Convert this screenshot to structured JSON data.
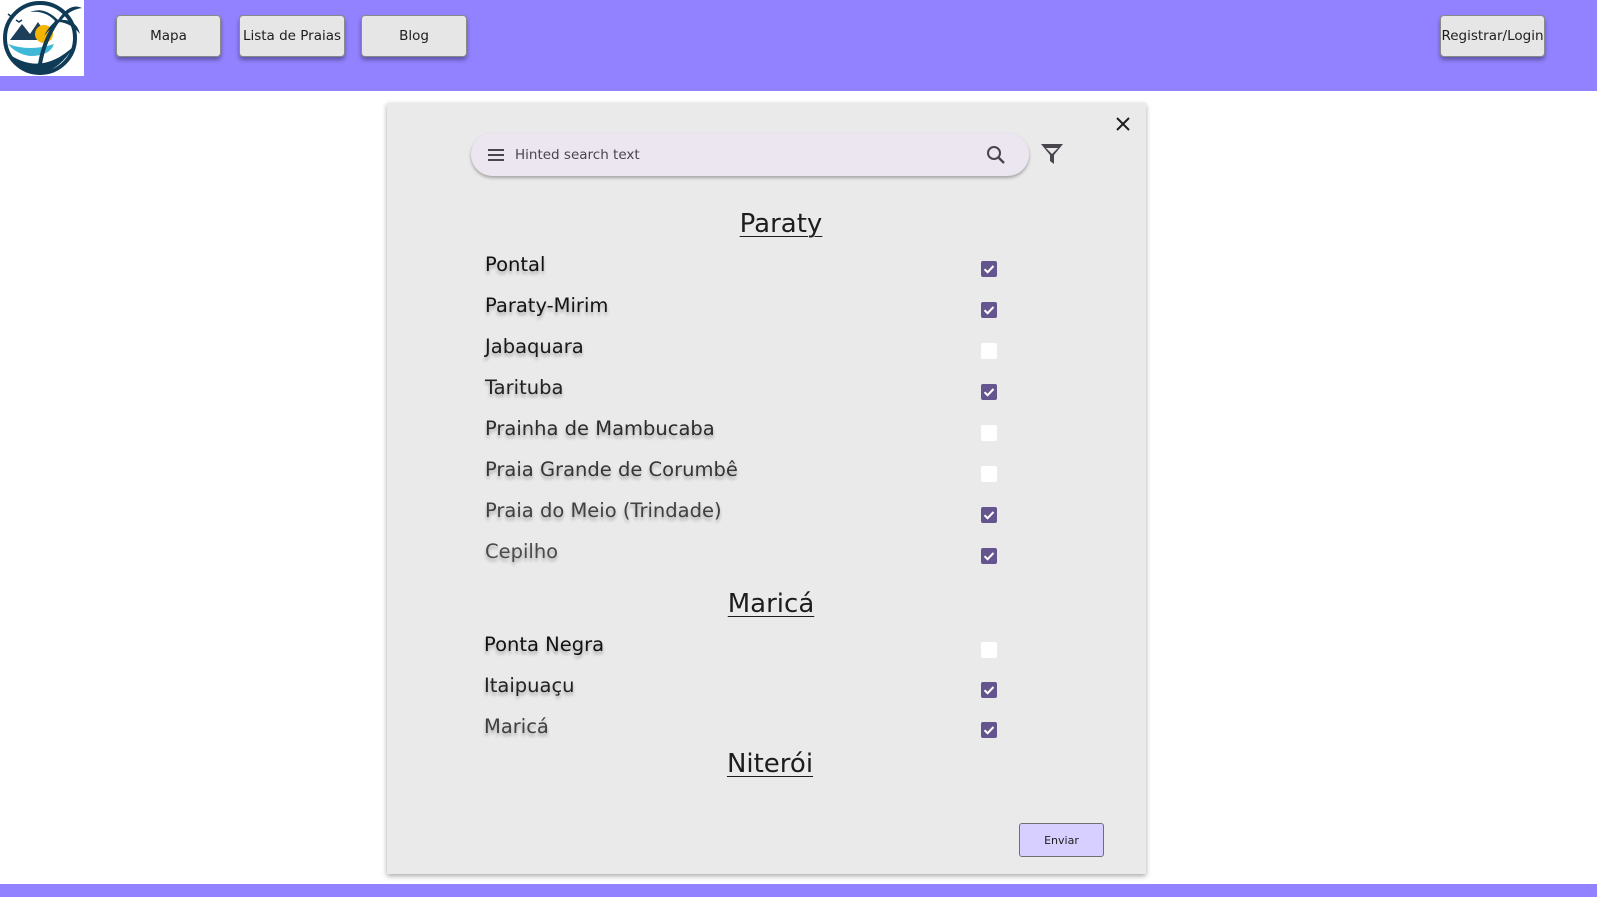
{
  "header": {
    "nav": [
      {
        "label": "Mapa"
      },
      {
        "label": "Lista de Praias"
      },
      {
        "label": "Blog"
      }
    ],
    "login_label": "Registrar/Login"
  },
  "search": {
    "placeholder": "Hinted search text"
  },
  "icons": {
    "menu": "menu-icon",
    "search": "search-icon",
    "filter": "filter-icon",
    "close": "close-icon",
    "logo": "palm-beach-logo"
  },
  "colors": {
    "brand": "#9282FF",
    "checkbox_checked": "#65558F",
    "send_button": "#D7CFFF",
    "panel": "#EAEAEA"
  },
  "groups": [
    {
      "city": "Paraty",
      "beaches": [
        {
          "name": "Pontal",
          "checked": true
        },
        {
          "name": "Paraty-Mirim",
          "checked": true
        },
        {
          "name": "Jabaquara",
          "checked": false
        },
        {
          "name": "Tarituba",
          "checked": true
        },
        {
          "name": "Prainha de Mambucaba",
          "checked": false
        },
        {
          "name": "Praia Grande de Corumbê",
          "checked": false
        },
        {
          "name": "Praia do Meio (Trindade)",
          "checked": true
        },
        {
          "name": "Cepilho",
          "checked": true
        }
      ]
    },
    {
      "city": "Maricá",
      "beaches": [
        {
          "name": "Ponta Negra",
          "checked": false
        },
        {
          "name": "Itaipuaçu",
          "checked": true
        },
        {
          "name": "Maricá",
          "checked": true
        }
      ]
    },
    {
      "city": "Niterói",
      "beaches": []
    }
  ],
  "submit_label": "Enviar"
}
